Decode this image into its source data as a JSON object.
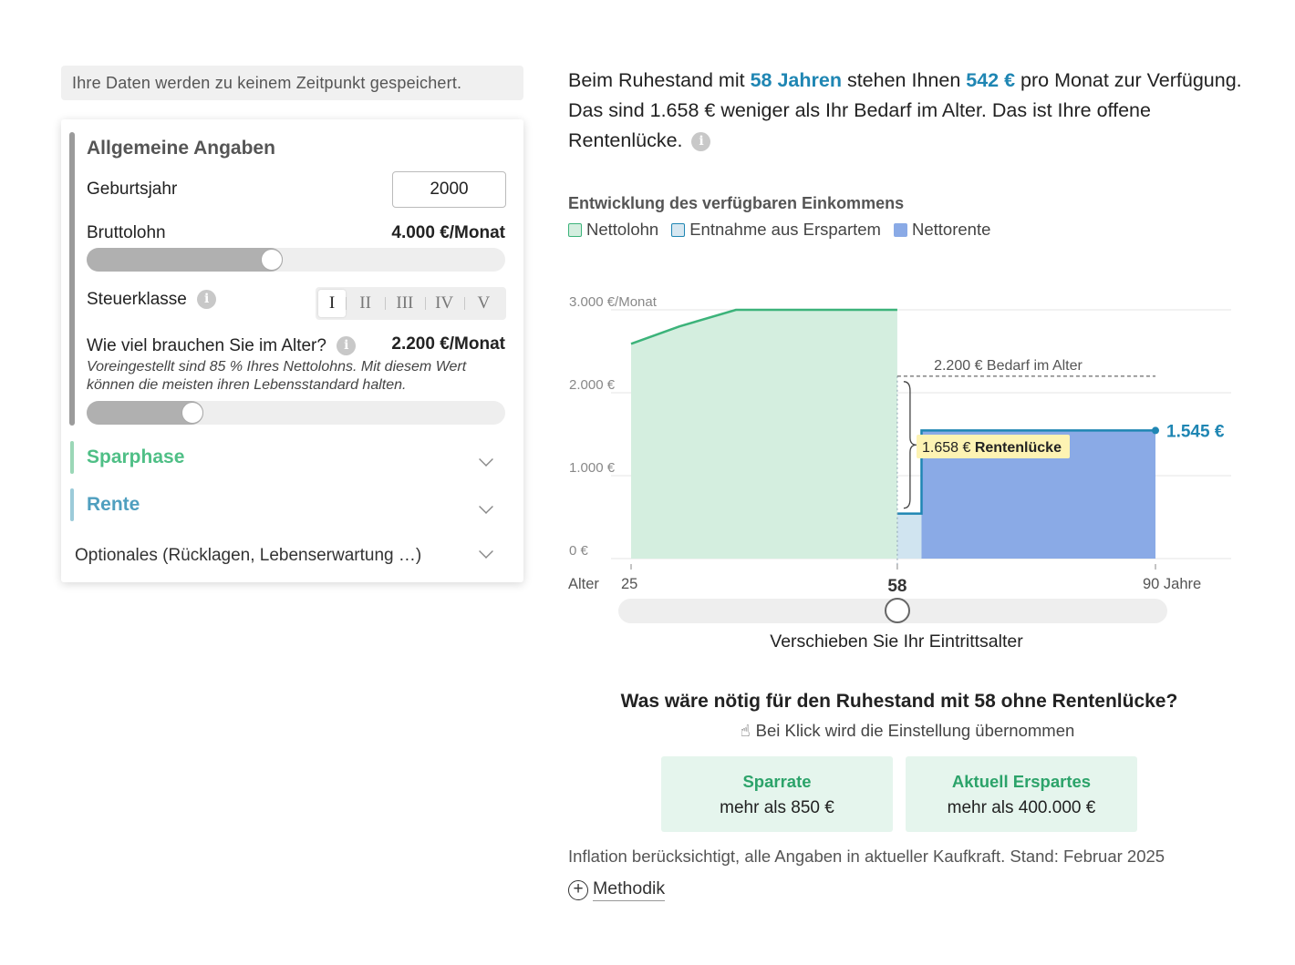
{
  "privacy_note": "Ihre Daten werden zu keinem Zeitpunkt gespeichert.",
  "panel": {
    "title": "Allgemeine Angaben",
    "birth_year": {
      "label": "Geburtsjahr",
      "value": "2000"
    },
    "gross_salary": {
      "label": "Bruttolohn",
      "value": "4.000 €/Monat",
      "slider_level": 0.44
    },
    "tax_class": {
      "label": "Steuerklasse",
      "options": [
        "I",
        "II",
        "III",
        "IV",
        "V"
      ],
      "selected": "I"
    },
    "need_in_age": {
      "label": "Wie viel brauchen Sie im Alter?",
      "value": "2.200 €/Monat",
      "hint": "Voreingestellt sind 85 % Ihres Nettolohns. Mit diesem Wert können die meisten ihren Lebensstandard halten.",
      "slider_level": 0.24
    },
    "sections": {
      "savings": "Sparphase",
      "pension": "Rente",
      "optional": "Optionales (Rücklagen, Lebenserwartung …)"
    }
  },
  "summary": {
    "p1": "Beim Ruhestand mit ",
    "age": "58 Jahren",
    "p2": " stehen Ihnen ",
    "amount": "542 €",
    "p3": " pro Monat zur Verfügung. Das sind 1.658 € weniger als Ihr Bedarf im Alter. Das ist Ihre offene Rentenlücke."
  },
  "chart_title": "Entwicklung des verfügbaren Einkommens",
  "legend": [
    "Nettolohn",
    "Entnahme aus Erspartem",
    "Nettorente"
  ],
  "chart_data": {
    "type": "area",
    "x_range": [
      25,
      90
    ],
    "ylim": [
      0,
      3000
    ],
    "y_ticks": [
      {
        "value": 3000,
        "label": "3.000 €/Monat"
      },
      {
        "value": 2000,
        "label": "2.000 €"
      },
      {
        "value": 1000,
        "label": "1.000 €"
      },
      {
        "value": 0,
        "label": "0 €"
      }
    ],
    "x_axis_prefix": "Alter",
    "x_ticks": [
      {
        "value": 25,
        "label": "25"
      },
      {
        "value": 58,
        "label": "58"
      },
      {
        "value": 90,
        "label": "90 Jahre"
      }
    ],
    "series": [
      {
        "name": "Nettolohn",
        "points": [
          [
            25,
            2590
          ],
          [
            31,
            2800
          ],
          [
            38,
            3000
          ],
          [
            58,
            3000
          ]
        ]
      },
      {
        "name": "Entnahme aus Erspartem",
        "points": [
          [
            58,
            542
          ],
          [
            61,
            542
          ]
        ]
      },
      {
        "name": "Nettorente",
        "points": [
          [
            61,
            1545
          ],
          [
            90,
            1545
          ]
        ]
      }
    ],
    "need_line": {
      "value": 2200,
      "from": 58,
      "to": 90,
      "label": "2.200 € Bedarf im Alter"
    },
    "gap_label": {
      "amount": "1.658 €",
      "text": "Rentenlücke"
    },
    "end_label": "1.545 €",
    "colors": {
      "net": "#3cb37a",
      "net_fill": "#d4eedf",
      "savings": "#1f86b3",
      "savings_fill": "#d0e4f0",
      "pension_fill": "#8aaae6",
      "accent": "#1f86b3"
    }
  },
  "retirement_slider": {
    "value": 58,
    "min": 25,
    "max": 90,
    "caption": "Verschieben Sie Ihr Eintrittsalter"
  },
  "suggestions": {
    "question": "Was wäre nötig für den Ruhestand mit 58 ohne Rentenlücke?",
    "hint": "Bei Klick wird die Einstellung übernommen",
    "cards": [
      {
        "title": "Sparrate",
        "value": "mehr als 850 €"
      },
      {
        "title": "Aktuell Erspartes",
        "value": "mehr als 400.000 €"
      }
    ]
  },
  "footnote": "Inflation berücksichtigt, alle Angaben in aktueller Kaufkraft. Stand: Februar 2025",
  "method_label": "Methodik"
}
